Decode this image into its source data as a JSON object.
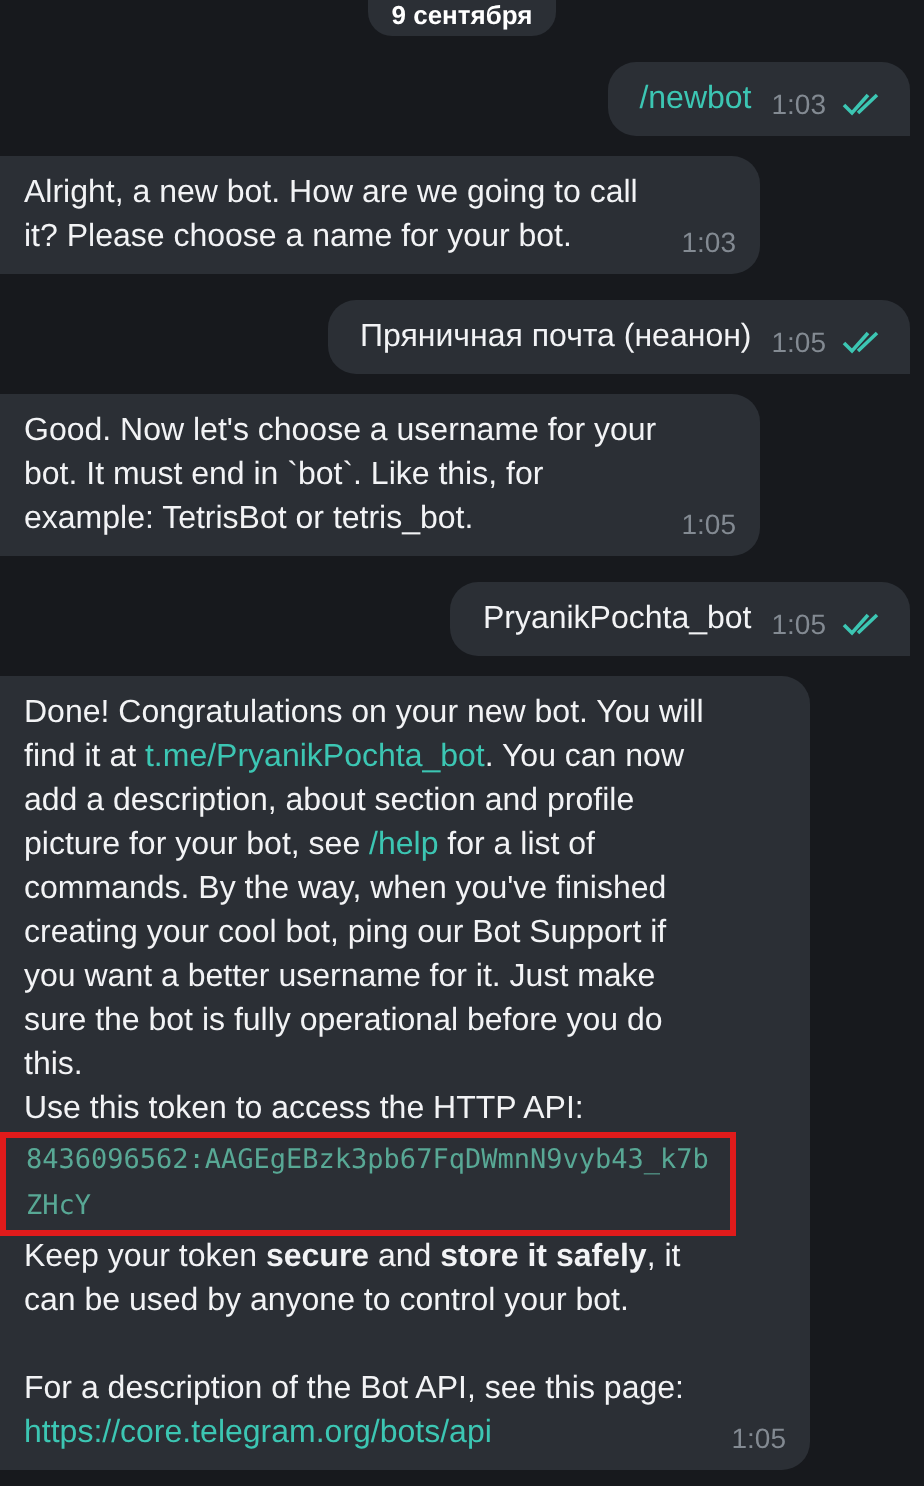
{
  "date_badge": "9 сентября",
  "messages": [
    {
      "kind": "outgoing",
      "time": "1:03",
      "read": true,
      "paragraphs": [
        [
          {
            "kind": "link",
            "text": "/newbot"
          }
        ]
      ]
    },
    {
      "kind": "incoming",
      "time": "1:03",
      "paragraphs": [
        [
          {
            "kind": "text",
            "text": "Alright, a new bot. How are we going to call it? Please choose a name for your bot."
          }
        ]
      ]
    },
    {
      "kind": "outgoing",
      "time": "1:05",
      "read": true,
      "paragraphs": [
        [
          {
            "kind": "text",
            "text": "Пряничная почта (неанон)"
          }
        ]
      ]
    },
    {
      "kind": "incoming",
      "time": "1:05",
      "paragraphs": [
        [
          {
            "kind": "text",
            "text": "Good. Now let's choose a username for your bot. It must end in `bot`. Like this, for example: TetrisBot or tetris_bot."
          }
        ]
      ]
    },
    {
      "kind": "outgoing",
      "time": "1:05",
      "read": true,
      "paragraphs": [
        [
          {
            "kind": "text",
            "text": "PryanikPochta_bot"
          }
        ]
      ]
    },
    {
      "kind": "incoming",
      "time": "1:05",
      "paragraphs": [
        [
          {
            "kind": "text",
            "text": "Done! Congratulations on your new bot. You will find it at "
          },
          {
            "kind": "link",
            "text": "t.me/PryanikPochta_bot"
          },
          {
            "kind": "text",
            "text": ". You can now add a description, about section and profile picture for your bot, see "
          },
          {
            "kind": "link",
            "text": "/help"
          },
          {
            "kind": "text",
            "text": " for a list of commands. By the way, when you've finished creating your cool bot, ping our Bot Support if you want a better username for it. Just make sure the bot is fully operational before you do this."
          }
        ],
        [
          {
            "kind": "text",
            "text": "Use this token to access the HTTP API:"
          }
        ],
        [
          {
            "kind": "code",
            "text": "8436096562:AAGEgEBzk3pb67FqDWmnN9vyb43_k7bZHcY",
            "highlighted": true
          }
        ],
        [
          {
            "kind": "text",
            "text": "Keep your token **secure** and **store it safely**, it can be used by anyone to control your bot."
          }
        ],
        [
          {
            "kind": "gap"
          }
        ],
        [
          {
            "kind": "text",
            "text": "For a description of the Bot API, see this page: "
          },
          {
            "kind": "link",
            "text": "https://core.telegram.org/bots/api"
          }
        ]
      ]
    }
  ]
}
